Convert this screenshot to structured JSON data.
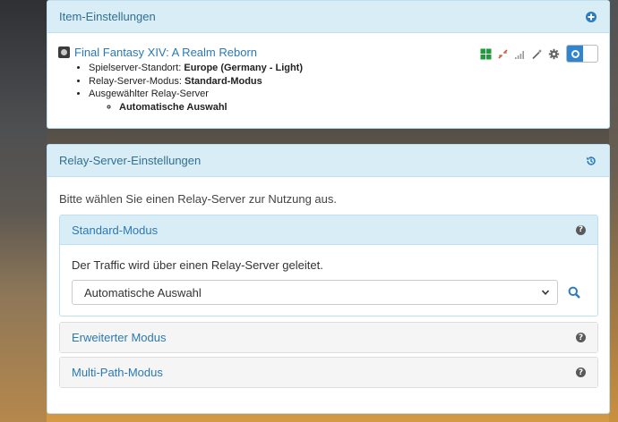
{
  "panel_item": {
    "title": "Item-Einstellungen",
    "game_title": "Final Fantasy XIV: A Realm Reborn",
    "details": {
      "location_label": "Spielserver-Standort:",
      "location_value": "Europe (Germany - Light)",
      "mode_label": "Relay-Server-Modus:",
      "mode_value": "Standard-Modus",
      "relay_label": "Ausgewählter Relay-Server",
      "relay_value": "Automatische Auswahl"
    },
    "icons": [
      "plus-circle-icon",
      "windows-icon",
      "disconnect-icon",
      "signal-icon",
      "magic-wand-icon",
      "gear-icon",
      "power-toggle"
    ]
  },
  "panel_relay": {
    "title": "Relay-Server-Einstellungen",
    "intro": "Bitte wählen Sie einen Relay-Server zur Nutzung aus.",
    "standard": {
      "title": "Standard-Modus",
      "description": "Der Traffic wird über einen Relay-Server geleitet.",
      "select_value": "Automatische Auswahl"
    },
    "advanced": {
      "title": "Erweiterter Modus"
    },
    "multipath": {
      "title": "Multi-Path-Modus"
    }
  },
  "colors": {
    "panel_header_bg": "#d9edf7",
    "link_blue": "#2a79b4",
    "header_text": "#31708f",
    "toggle_blue": "#2f85cf"
  }
}
